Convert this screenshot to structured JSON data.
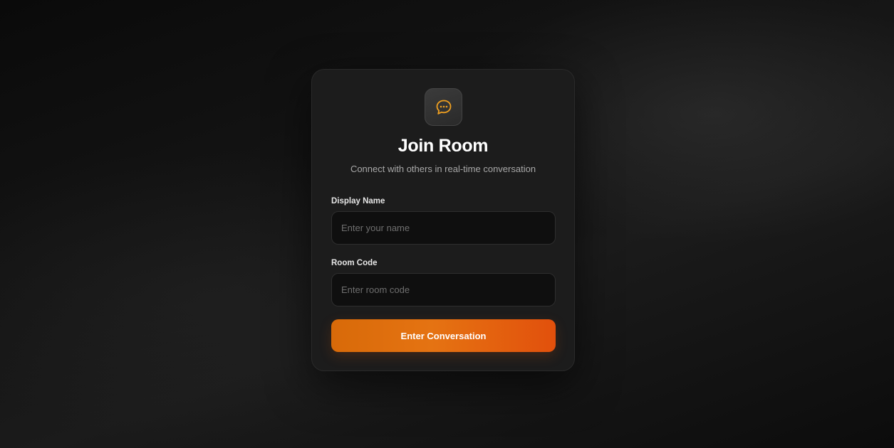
{
  "card": {
    "icon": "chat-bubble-icon",
    "title": "Join Room",
    "subtitle": "Connect with others in real-time conversation"
  },
  "form": {
    "display_name": {
      "label": "Display Name",
      "value": "",
      "placeholder": "Enter your name"
    },
    "room_code": {
      "label": "Room Code",
      "value": "",
      "placeholder": "Enter room code"
    },
    "submit_label": "Enter Conversation"
  },
  "colors": {
    "accent": "#e57312",
    "accent_end": "#e2500c",
    "icon": "#f0a020",
    "card_bg": "#1c1c1c",
    "page_bg": "#0a0a0a"
  }
}
